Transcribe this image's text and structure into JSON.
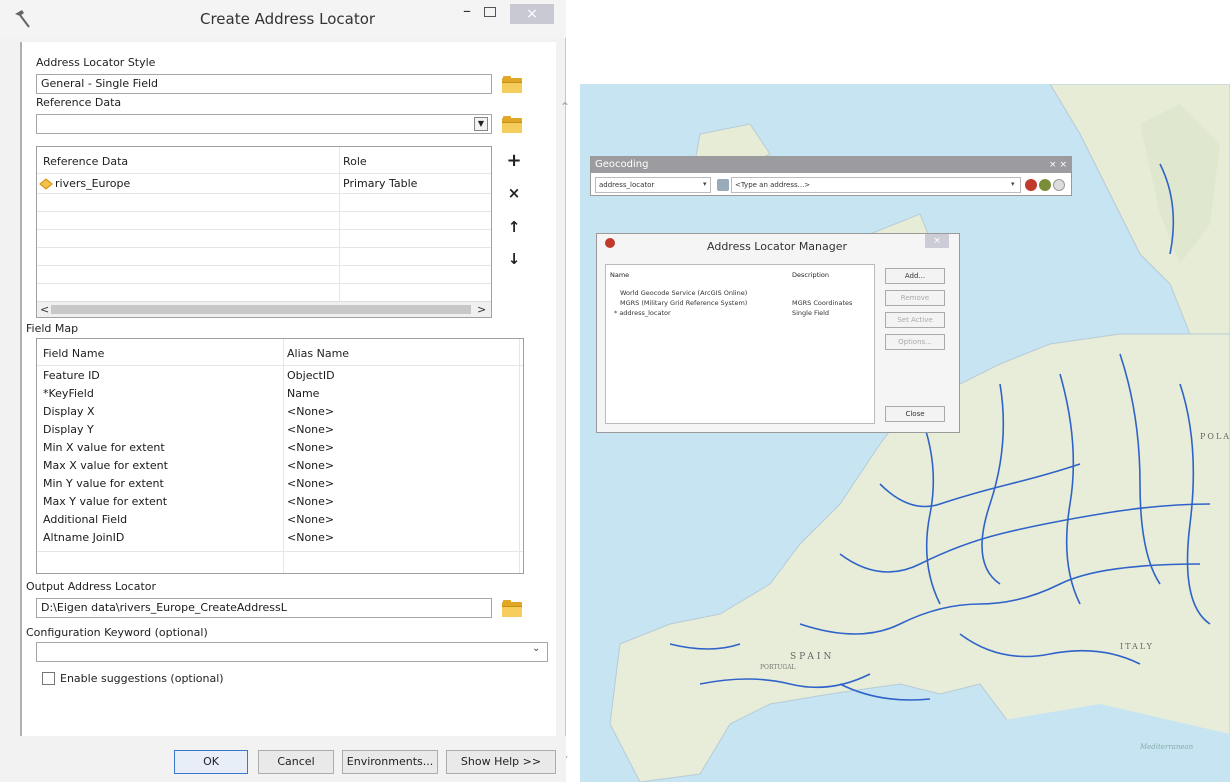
{
  "dialog": {
    "title": "Create Address Locator",
    "close_glyph": "×",
    "minimize_glyph": "–",
    "sections": {
      "style_label": "Address Locator Style",
      "style_value": "General - Single Field",
      "ref_label": "Reference Data",
      "ref_value": "",
      "fieldmap_label": "Field Map",
      "output_label": "Output Address Locator",
      "output_value": "D:\\Eigen data\\rivers_Europe_CreateAddressL",
      "config_label": "Configuration Keyword (optional)",
      "config_value": "",
      "suggest_label": "Enable suggestions (optional)"
    },
    "ref_table": {
      "headers": [
        "Reference Data",
        "Role"
      ],
      "rows": [
        {
          "name": "rivers_Europe",
          "role": "Primary Table"
        }
      ]
    },
    "side_buttons": [
      "+",
      "×",
      "↑",
      "↓"
    ],
    "field_map": {
      "headers": [
        "Field Name",
        "Alias Name"
      ],
      "rows": [
        {
          "field": "Feature ID",
          "alias": "ObjectID"
        },
        {
          "field": "*KeyField",
          "alias": "Name"
        },
        {
          "field": "Display X",
          "alias": "<None>"
        },
        {
          "field": "Display Y",
          "alias": "<None>"
        },
        {
          "field": "Min X value for extent",
          "alias": "<None>"
        },
        {
          "field": "Max X value for extent",
          "alias": "<None>"
        },
        {
          "field": "Min Y value for extent",
          "alias": "<None>"
        },
        {
          "field": "Max Y value for extent",
          "alias": "<None>"
        },
        {
          "field": "Additional Field",
          "alias": "<None>"
        },
        {
          "field": "Altname JoinID",
          "alias": "<None>"
        }
      ]
    },
    "buttons": {
      "ok": "OK",
      "cancel": "Cancel",
      "environments": "Environments...",
      "help": "Show Help >>"
    }
  },
  "geocoding_toolbar": {
    "title": "Geocoding",
    "close_glyph": "× ×",
    "locator": "address_locator",
    "address_placeholder": "<Type an address...>"
  },
  "locator_manager": {
    "title": "Address Locator Manager",
    "close_glyph": "×",
    "headers": [
      "Name",
      "Description"
    ],
    "rows": [
      {
        "name": "World Geocode Service (ArcGIS Online)",
        "desc": ""
      },
      {
        "name": "MGRS (Military Grid Reference System)",
        "desc": "MGRS Coordinates"
      },
      {
        "name": "* address_locator",
        "desc": "Single Field"
      }
    ],
    "buttons": {
      "add": "Add...",
      "remove": "Remove",
      "set_active": "Set Active",
      "options": "Options...",
      "close": "Close"
    }
  },
  "map_labels": [
    "SPAIN",
    "PORTUGAL",
    "ITALY",
    "POLAND",
    "Mediterranean"
  ],
  "colors": {
    "water": "#c6e4f2",
    "land": "#e8edd9",
    "river": "#2f63c9",
    "accent": "#3a79c9"
  }
}
